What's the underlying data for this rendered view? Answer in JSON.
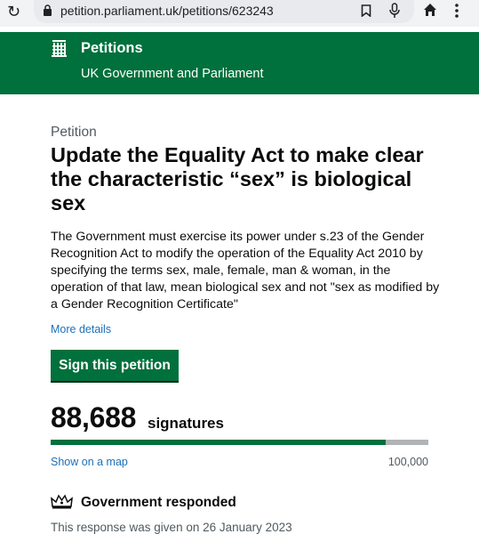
{
  "browser": {
    "url": "petition.parliament.uk/petitions/623243",
    "icons": [
      "reload-icon",
      "lock-icon",
      "bookmark-icon",
      "mic-icon",
      "home-icon",
      "menu-icon"
    ]
  },
  "header": {
    "title": "Petitions",
    "subtitle": "UK Government and Parliament",
    "logo_icon": "portcullis-icon",
    "background": "#00703c"
  },
  "petition": {
    "caption": "Petition",
    "title": "Update the Equality Act to make clear the characteristic “sex” is biological sex",
    "body": "The Government must exercise its power under s.23 of the Gender Recognition Act to modify the operation of the Equality Act 2010 by specifying the terms sex, male, female, man & woman, in the operation of that law, mean biological sex and not \"sex as modified by a Gender Recognition Certificate\"",
    "more_details": "More details",
    "sign_label": "Sign this petition"
  },
  "signatures": {
    "count": "88,688",
    "label": "signatures",
    "progress_fraction": 0.88688,
    "show_map": "Show on a map",
    "target": "100,000"
  },
  "response": {
    "icon": "crown-icon",
    "title": "Government responded",
    "date_text": "This response was given on 26 January 2023"
  },
  "colors": {
    "brand_green": "#00703c",
    "link_blue": "#1d70b8",
    "text": "#0b0c0c",
    "secondary_text": "#505a5f"
  }
}
